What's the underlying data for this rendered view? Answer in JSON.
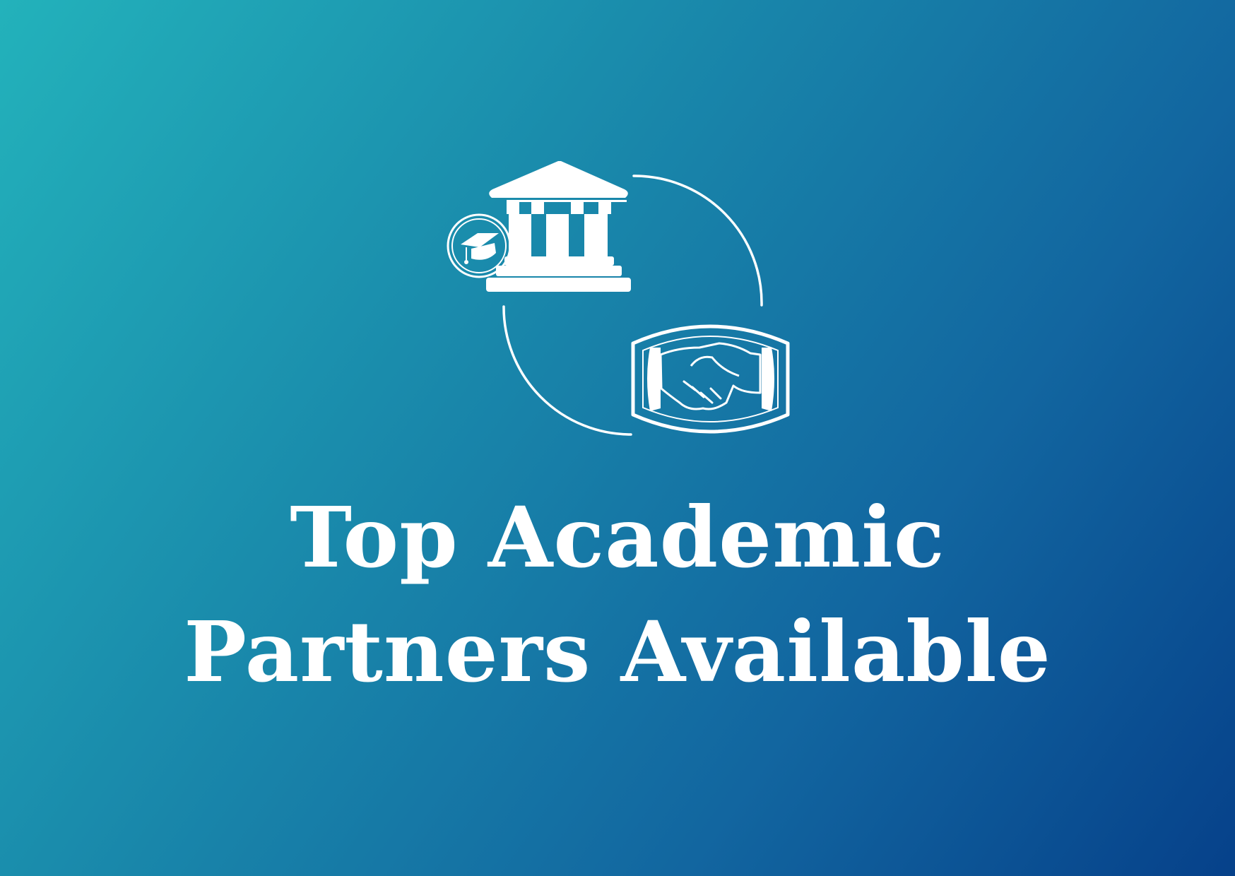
{
  "headline": {
    "line1": "Top Academic",
    "line2": "Partners Available"
  },
  "colors": {
    "gradient_start": "#23b2bb",
    "gradient_end": "#06418a",
    "foreground": "#ffffff"
  },
  "icons": {
    "institution": "university-building-icon",
    "graduation": "graduation-cap-icon",
    "partnership": "handshake-icon",
    "cycle": "circular-arrow-icon"
  }
}
